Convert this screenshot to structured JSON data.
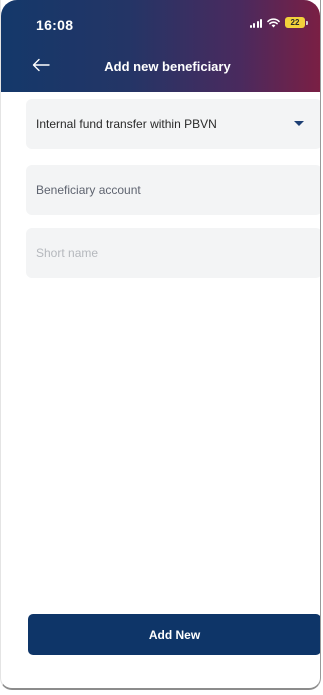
{
  "status_bar": {
    "time": "16:08",
    "battery": "22",
    "icons": [
      "signal-icon",
      "wifi-icon",
      "battery-icon"
    ]
  },
  "header": {
    "title": "Add new beneficiary",
    "back_icon": "arrow-left-icon"
  },
  "form": {
    "transfer_type": "Internal fund transfer within PBVN",
    "beneficiary_account_placeholder": "Beneficiary account",
    "short_name_placeholder": "Short name"
  },
  "actions": {
    "add_new_label": "Add New"
  },
  "colors": {
    "header_gradient_start": "#14386a",
    "header_gradient_end": "#7a1f44",
    "primary_button": "#0e3568",
    "field_background": "#f3f4f5",
    "battery": "#f2d13b"
  }
}
